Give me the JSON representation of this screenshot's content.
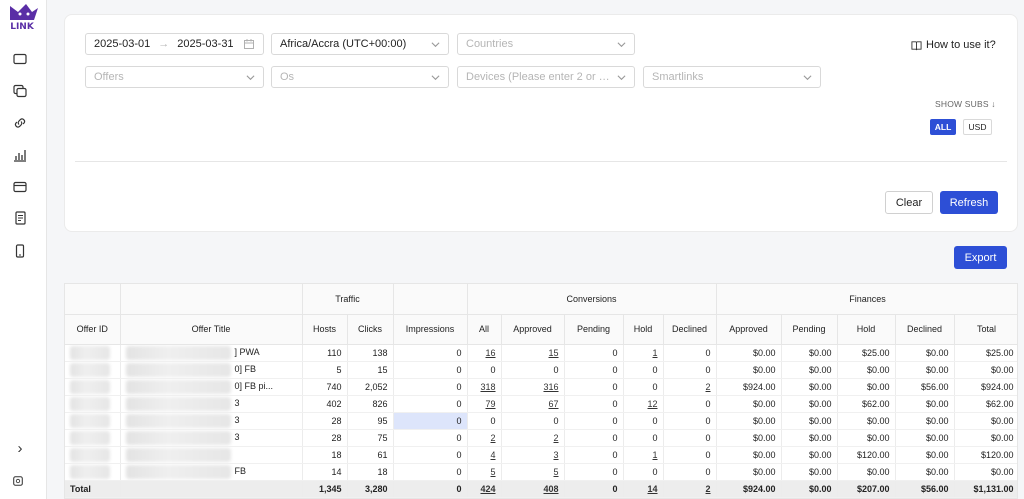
{
  "sidebar": {
    "icons": [
      "logo-icon",
      "window-icon",
      "copy-icon",
      "link-icon",
      "bar-chart-icon",
      "card-icon",
      "document-icon",
      "phone-icon",
      "chevron-right-icon",
      "settings-icon"
    ],
    "logo_text": "LINK"
  },
  "filters": {
    "date_start": "2025-03-01",
    "date_arrow": "→",
    "date_end": "2025-03-31",
    "timezone": "Africa/Accra (UTC+00:00)",
    "countries_placeholder": "Countries",
    "offers_placeholder": "Offers",
    "os_placeholder": "Os",
    "devices_placeholder": "Devices (Please enter 2 or m...",
    "smartlinks_placeholder": "Smartlinks",
    "how_to": "How to use it?",
    "show_subs": "SHOW SUBS ↓",
    "currency_all": "ALL",
    "currency_usd": "USD",
    "clear": "Clear",
    "refresh": "Refresh"
  },
  "export": "Export",
  "table": {
    "group_headers": {
      "traffic": "Traffic",
      "conversions": "Conversions",
      "finances": "Finances"
    },
    "columns": [
      "Offer ID",
      "Offer Title",
      "Hosts",
      "Clicks",
      "Impressions",
      "All",
      "Approved",
      "Pending",
      "Hold",
      "Declined",
      "Approved",
      "Pending",
      "Hold",
      "Declined",
      "Total"
    ],
    "rows": [
      {
        "title_suffix": "] PWA",
        "hosts": "110",
        "clicks": "138",
        "impressions": "0",
        "all": "16",
        "approved": "15",
        "pending": "0",
        "hold": "1",
        "declined": "0",
        "f_approved": "$0.00",
        "f_pending": "$0.00",
        "f_hold": "$25.00",
        "f_declined": "$0.00",
        "f_total": "$25.00"
      },
      {
        "title_suffix": "0] FB",
        "hosts": "5",
        "clicks": "15",
        "impressions": "0",
        "all": "0",
        "approved": "0",
        "pending": "0",
        "hold": "0",
        "declined": "0",
        "f_approved": "$0.00",
        "f_pending": "$0.00",
        "f_hold": "$0.00",
        "f_declined": "$0.00",
        "f_total": "$0.00"
      },
      {
        "title_suffix": "0] FB pi...",
        "hosts": "740",
        "clicks": "2,052",
        "impressions": "0",
        "all": "318",
        "approved": "316",
        "pending": "0",
        "hold": "0",
        "declined": "2",
        "f_approved": "$924.00",
        "f_pending": "$0.00",
        "f_hold": "$0.00",
        "f_declined": "$56.00",
        "f_total": "$924.00"
      },
      {
        "title_suffix": "3",
        "hosts": "402",
        "clicks": "826",
        "impressions": "0",
        "all": "79",
        "approved": "67",
        "pending": "0",
        "hold": "12",
        "declined": "0",
        "f_approved": "$0.00",
        "f_pending": "$0.00",
        "f_hold": "$62.00",
        "f_declined": "$0.00",
        "f_total": "$62.00"
      },
      {
        "title_suffix": "3",
        "hosts": "28",
        "clicks": "95",
        "impressions": "0",
        "all": "0",
        "approved": "0",
        "pending": "0",
        "hold": "0",
        "declined": "0",
        "f_approved": "$0.00",
        "f_pending": "$0.00",
        "f_hold": "$0.00",
        "f_declined": "$0.00",
        "f_total": "$0.00"
      },
      {
        "title_suffix": "3",
        "hosts": "28",
        "clicks": "75",
        "impressions": "0",
        "all": "2",
        "approved": "2",
        "pending": "0",
        "hold": "0",
        "declined": "0",
        "f_approved": "$0.00",
        "f_pending": "$0.00",
        "f_hold": "$0.00",
        "f_declined": "$0.00",
        "f_total": "$0.00"
      },
      {
        "title_suffix": "",
        "hosts": "18",
        "clicks": "61",
        "impressions": "0",
        "all": "4",
        "approved": "3",
        "pending": "0",
        "hold": "1",
        "declined": "0",
        "f_approved": "$0.00",
        "f_pending": "$0.00",
        "f_hold": "$120.00",
        "f_declined": "$0.00",
        "f_total": "$120.00"
      },
      {
        "title_suffix": "FB",
        "hosts": "14",
        "clicks": "18",
        "impressions": "0",
        "all": "5",
        "approved": "5",
        "pending": "0",
        "hold": "0",
        "declined": "0",
        "f_approved": "$0.00",
        "f_pending": "$0.00",
        "f_hold": "$0.00",
        "f_declined": "$0.00",
        "f_total": "$0.00"
      }
    ],
    "total": {
      "label": "Total",
      "hosts": "1,345",
      "clicks": "3,280",
      "impressions": "0",
      "all": "424",
      "approved": "408",
      "pending": "0",
      "hold": "14",
      "declined": "2",
      "f_approved": "$924.00",
      "f_pending": "$0.00",
      "f_hold": "$207.00",
      "f_declined": "$56.00",
      "f_total": "$1,131.00"
    }
  },
  "colors": {
    "accent": "#2d4fd6",
    "logo": "#5a2ea6"
  }
}
